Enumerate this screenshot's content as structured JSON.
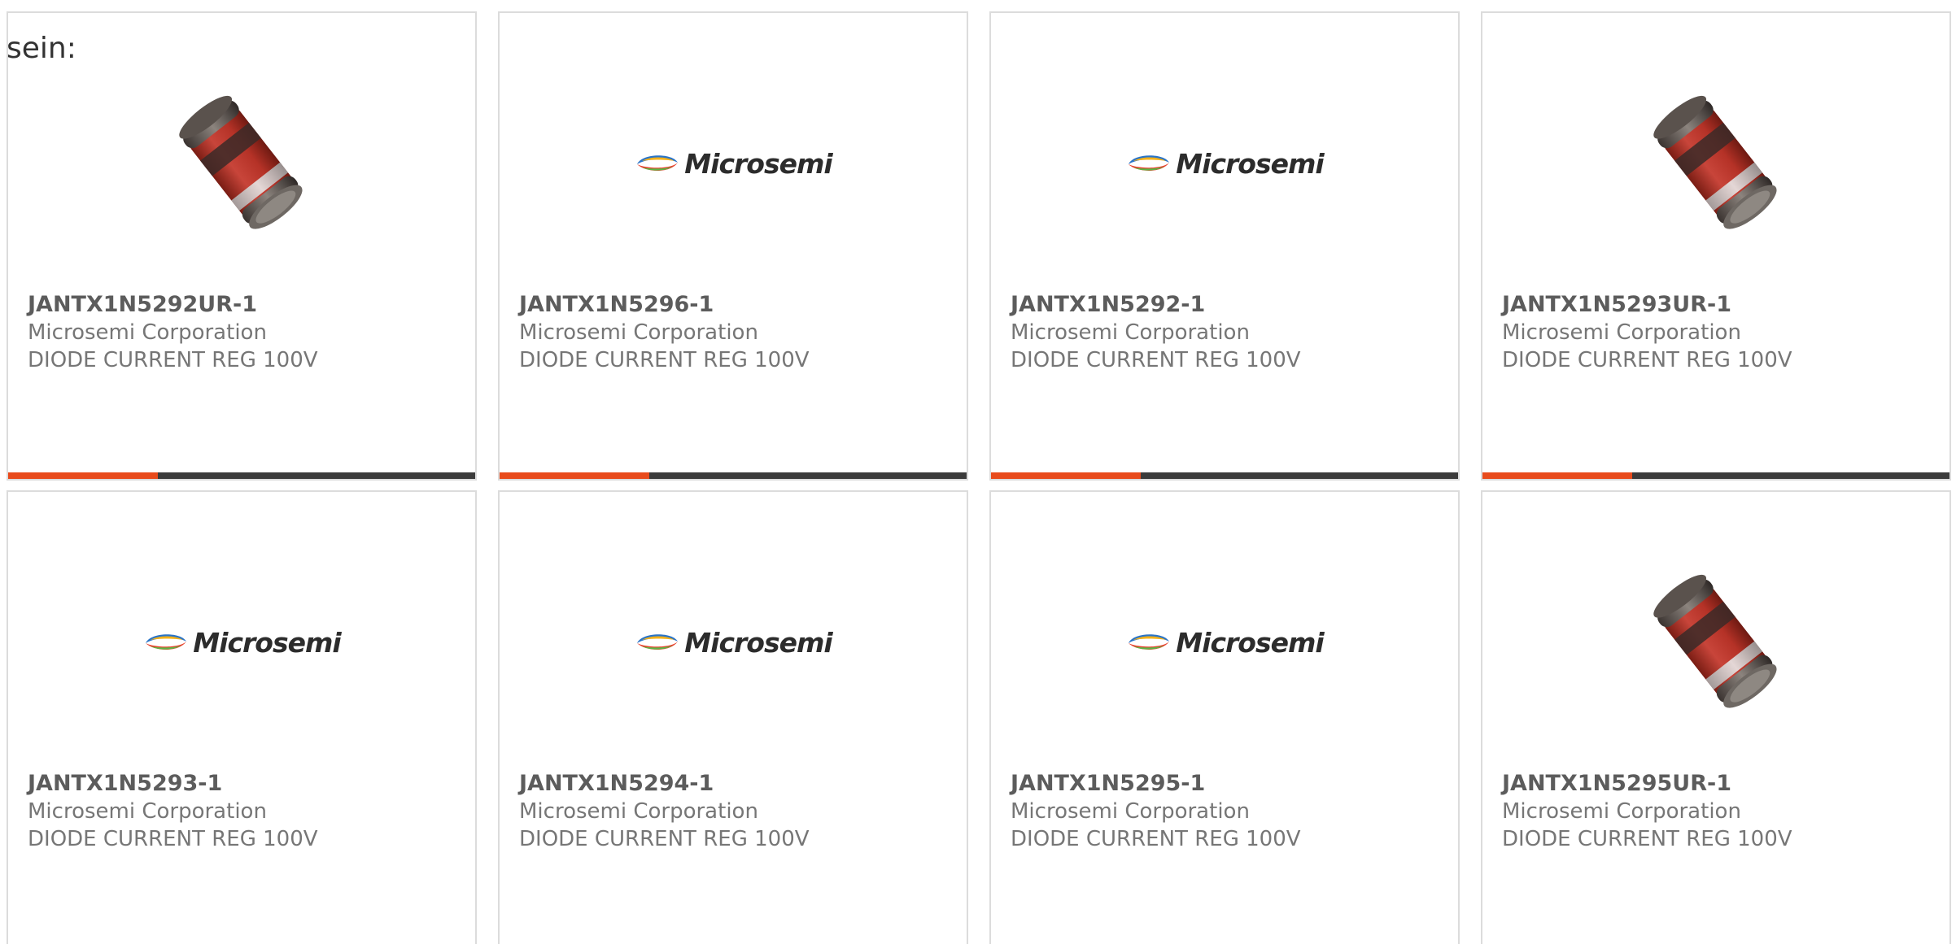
{
  "lead_text": "sein:",
  "colors": {
    "card_border": "#dcdcdc",
    "accent": "#e84b1c",
    "bar_dark": "#3b3b3b",
    "part_text": "#5c5c5c",
    "meta_text": "#767676"
  },
  "products": [
    {
      "part_number": "JANTX1N5292UR-1",
      "manufacturer": "Microsemi Corporation",
      "description": "DIODE CURRENT REG 100V",
      "image_type": "diode-image",
      "has_bar": true
    },
    {
      "part_number": "JANTX1N5296-1",
      "manufacturer": "Microsemi Corporation",
      "description": "DIODE CURRENT REG 100V",
      "image_type": "microsemi-logo",
      "logo_text": "Microsemi",
      "has_bar": true
    },
    {
      "part_number": "JANTX1N5292-1",
      "manufacturer": "Microsemi Corporation",
      "description": "DIODE CURRENT REG 100V",
      "image_type": "microsemi-logo",
      "logo_text": "Microsemi",
      "has_bar": true
    },
    {
      "part_number": "JANTX1N5293UR-1",
      "manufacturer": "Microsemi Corporation",
      "description": "DIODE CURRENT REG 100V",
      "image_type": "diode-image",
      "has_bar": true
    },
    {
      "part_number": "JANTX1N5293-1",
      "manufacturer": "Microsemi Corporation",
      "description": "DIODE CURRENT REG 100V",
      "image_type": "microsemi-logo",
      "logo_text": "Microsemi",
      "has_bar": false
    },
    {
      "part_number": "JANTX1N5294-1",
      "manufacturer": "Microsemi Corporation",
      "description": "DIODE CURRENT REG 100V",
      "image_type": "microsemi-logo",
      "logo_text": "Microsemi",
      "has_bar": false
    },
    {
      "part_number": "JANTX1N5295-1",
      "manufacturer": "Microsemi Corporation",
      "description": "DIODE CURRENT REG 100V",
      "image_type": "microsemi-logo",
      "logo_text": "Microsemi",
      "has_bar": false
    },
    {
      "part_number": "JANTX1N5295UR-1",
      "manufacturer": "Microsemi Corporation",
      "description": "DIODE CURRENT REG 100V",
      "image_type": "diode-image",
      "has_bar": false
    }
  ]
}
